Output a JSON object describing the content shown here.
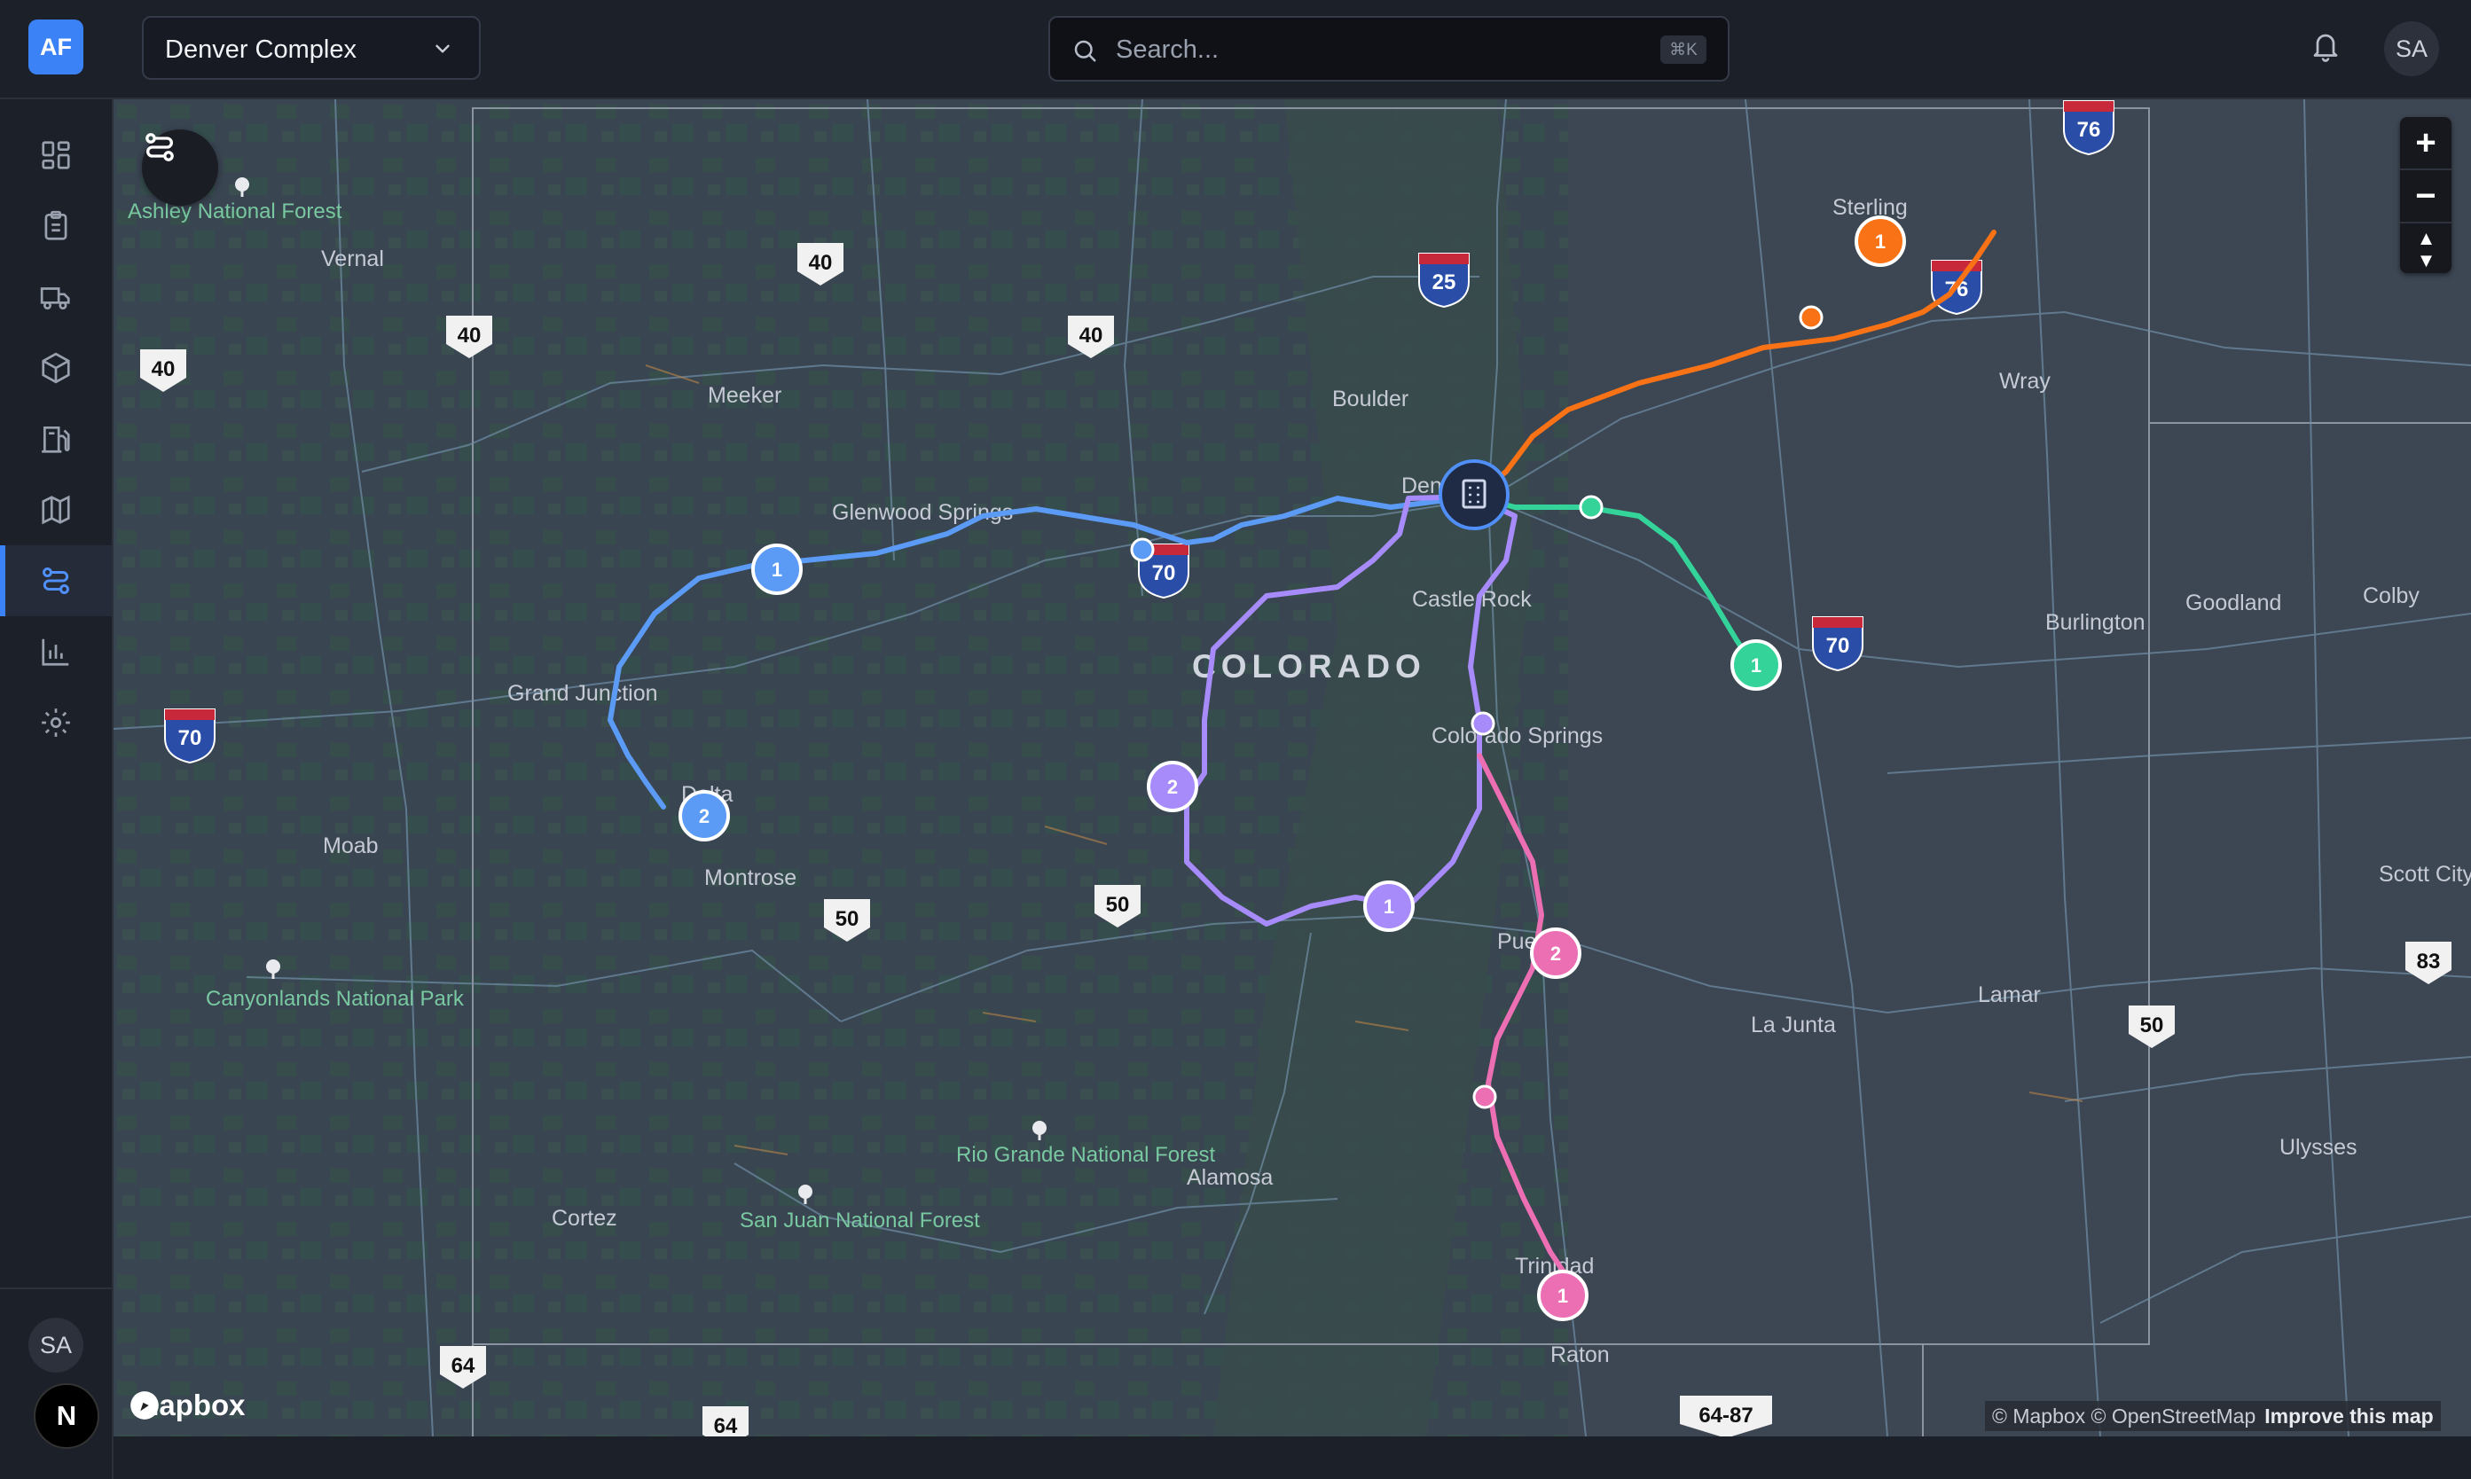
{
  "app": {
    "logo_text": "AF"
  },
  "header": {
    "complex_select": {
      "value": "Denver Complex"
    },
    "search": {
      "placeholder": "Search...",
      "shortcut": "⌘K"
    },
    "user_initials": "SA"
  },
  "sidebar": {
    "items": [
      {
        "name": "dashboard",
        "icon": "dashboard-grid-icon"
      },
      {
        "name": "orders",
        "icon": "clipboard-icon"
      },
      {
        "name": "fleet",
        "icon": "truck-icon"
      },
      {
        "name": "inventory",
        "icon": "package-icon"
      },
      {
        "name": "fuel",
        "icon": "fuel-pump-icon"
      },
      {
        "name": "map",
        "icon": "map-icon"
      },
      {
        "name": "routes",
        "icon": "route-icon",
        "active": true
      },
      {
        "name": "analytics",
        "icon": "bar-chart-icon"
      },
      {
        "name": "settings",
        "icon": "gear-icon"
      }
    ],
    "user_initials": "SA",
    "badge_letter": "N"
  },
  "map": {
    "state_label": "COLORADO",
    "attribution": "© Mapbox © OpenStreetMap",
    "improve_link": "Improve this map",
    "brand": "mapbox",
    "zoom_in": "+",
    "zoom_out": "−",
    "compass": "▲▼",
    "colors": {
      "blue_route": "#5b9bf5",
      "purple_route": "#a78bfa",
      "orange_route": "#f97316",
      "green_route": "#34d399",
      "pink_route": "#ec6fb4",
      "depot": "#1f2a44"
    },
    "cities": [
      "Vernal",
      "Meeker",
      "Glenwood Springs",
      "Grand Junction",
      "Delta",
      "Montrose",
      "Moab",
      "Cortez",
      "Alamosa",
      "Boulder",
      "Denver",
      "Castle Rock",
      "Colorado Springs",
      "Pueblo",
      "La Junta",
      "Lamar",
      "Trinidad",
      "Raton",
      "Sterling",
      "Wray",
      "Burlington",
      "Goodland",
      "Colby",
      "Scott City",
      "Ulysses"
    ],
    "forests": [
      "Ashley National Forest",
      "Canyonlands National Park",
      "Rio Grande National Forest",
      "San Juan National Forest"
    ],
    "highway_shields": [
      "40",
      "40",
      "40",
      "40",
      "25",
      "76",
      "76",
      "70",
      "70",
      "70",
      "70",
      "50",
      "50",
      "50",
      "83",
      "64",
      "64",
      "64-87"
    ],
    "stops": {
      "blue": [
        "1",
        "2"
      ],
      "purple": [
        "2",
        "1"
      ],
      "orange": [
        "1"
      ],
      "green": [
        "1"
      ],
      "pink": [
        "2",
        "1"
      ]
    }
  }
}
